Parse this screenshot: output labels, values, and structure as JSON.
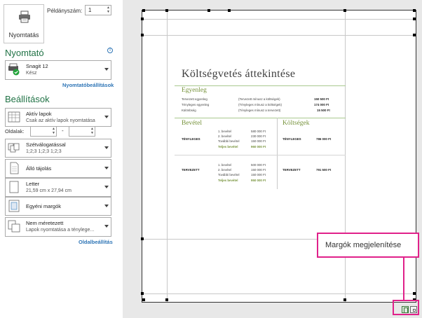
{
  "print": {
    "button_label": "Nyomtatás",
    "copies_label": "Példányszám:",
    "copies_value": "1"
  },
  "printer": {
    "section_title": "Nyomtató",
    "name": "Snagit 12",
    "status": "Kész",
    "properties_link": "Nyomtatóbeállítások",
    "info_icon": "i"
  },
  "settings": {
    "section_title": "Beállítások",
    "scope_title": "Aktív lapok",
    "scope_desc": "Csak az aktív lapok nyomtatása",
    "pages_label": "Oldalak:",
    "pages_dash": "-",
    "collate_title": "Szétválogatással",
    "collate_desc": "1;2;3    1;2;3    1;2;3",
    "orientation": "Álló tájolás",
    "paper_title": "Letter",
    "paper_desc": "21,59 cm x 27,94 cm",
    "margins": "Egyéni margók",
    "scaling_title": "Nem méretezett",
    "scaling_desc": "Lapok nyomtatása a ténylege...",
    "page_setup_link": "Oldalbeállítás"
  },
  "preview": {
    "title": "Költségvetés áttekintése",
    "balance": {
      "heading": "Egyenleg",
      "rows": [
        {
          "label": "Tervezett egyenleg",
          "desc": "(Tervezett mínusz a költségek)",
          "value": "150 500 Ft"
        },
        {
          "label": "Tényleges egyenleg",
          "desc": "(Tényleges mínusz a költségek)",
          "value": "174 000 Ft"
        },
        {
          "label": "Különbség",
          "desc": "(Tényleges mínusz a tervezett)",
          "value": "15 500 Ft"
        }
      ]
    },
    "income_heading": "Bevétel",
    "expense_heading": "Költségek",
    "actual": {
      "label": "TÉNYLEGES",
      "items": [
        {
          "name": "1. bevétel",
          "value": "580 000 Ft"
        },
        {
          "name": "2. bevétel",
          "value": "230 000 Ft"
        },
        {
          "name": "További bevétel",
          "value": "150 000 Ft"
        }
      ],
      "total_name": "Teljes bevétel",
      "total_value": "960 000 Ft",
      "expense_label": "TÉNYLEGES",
      "expense_value": "786 000 Ft"
    },
    "planned": {
      "label": "TERVEZETT",
      "items": [
        {
          "name": "1. bevétel",
          "value": "500 000 Ft"
        },
        {
          "name": "2. bevétel",
          "value": "150 000 Ft"
        },
        {
          "name": "További bevétel",
          "value": "150 000 Ft"
        }
      ],
      "total_name": "Teljes bevétel",
      "total_value": "950 000 Ft",
      "expense_label": "TERVEZETT",
      "expense_value": "791 500 Ft"
    }
  },
  "callout": {
    "text": "Margók megjelenítése"
  },
  "colors": {
    "accent_green": "#217346",
    "link_blue": "#2e75b6",
    "callout_pink": "#e0218a",
    "doc_green": "#77933c"
  }
}
